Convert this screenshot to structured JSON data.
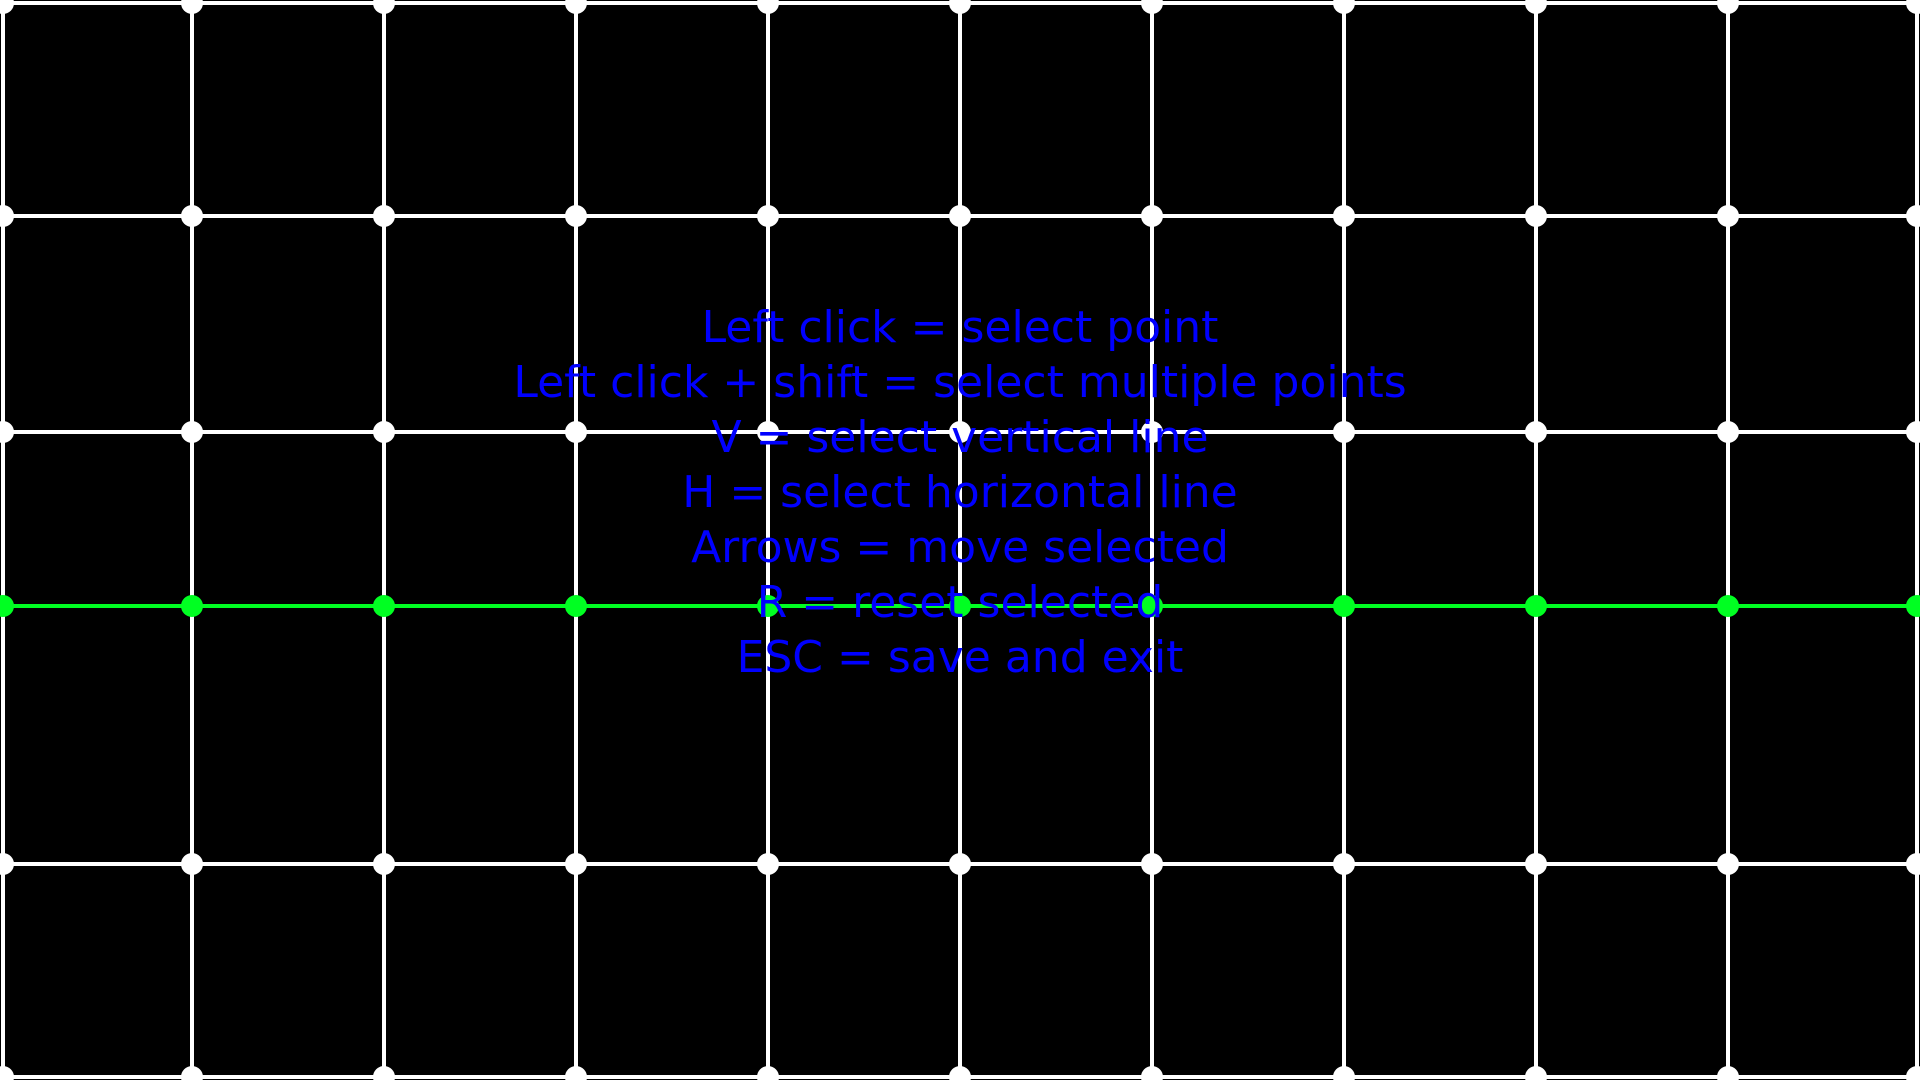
{
  "grid": {
    "columns": 10,
    "rows": 5,
    "selected_line": {
      "orientation": "horizontal",
      "index": 3
    },
    "colors": {
      "background": "#000000",
      "line": "#ffffff",
      "point": "#ffffff",
      "selected": "#00ff22",
      "help_text": "#0000ff"
    }
  },
  "help": {
    "lines": [
      "Left click = select point",
      "Left click + shift = select multiple points",
      "V = select vertical line",
      "H = select horizontal line",
      "Arrows = move selected",
      "R = reset selected",
      "ESC = save and exit"
    ]
  }
}
